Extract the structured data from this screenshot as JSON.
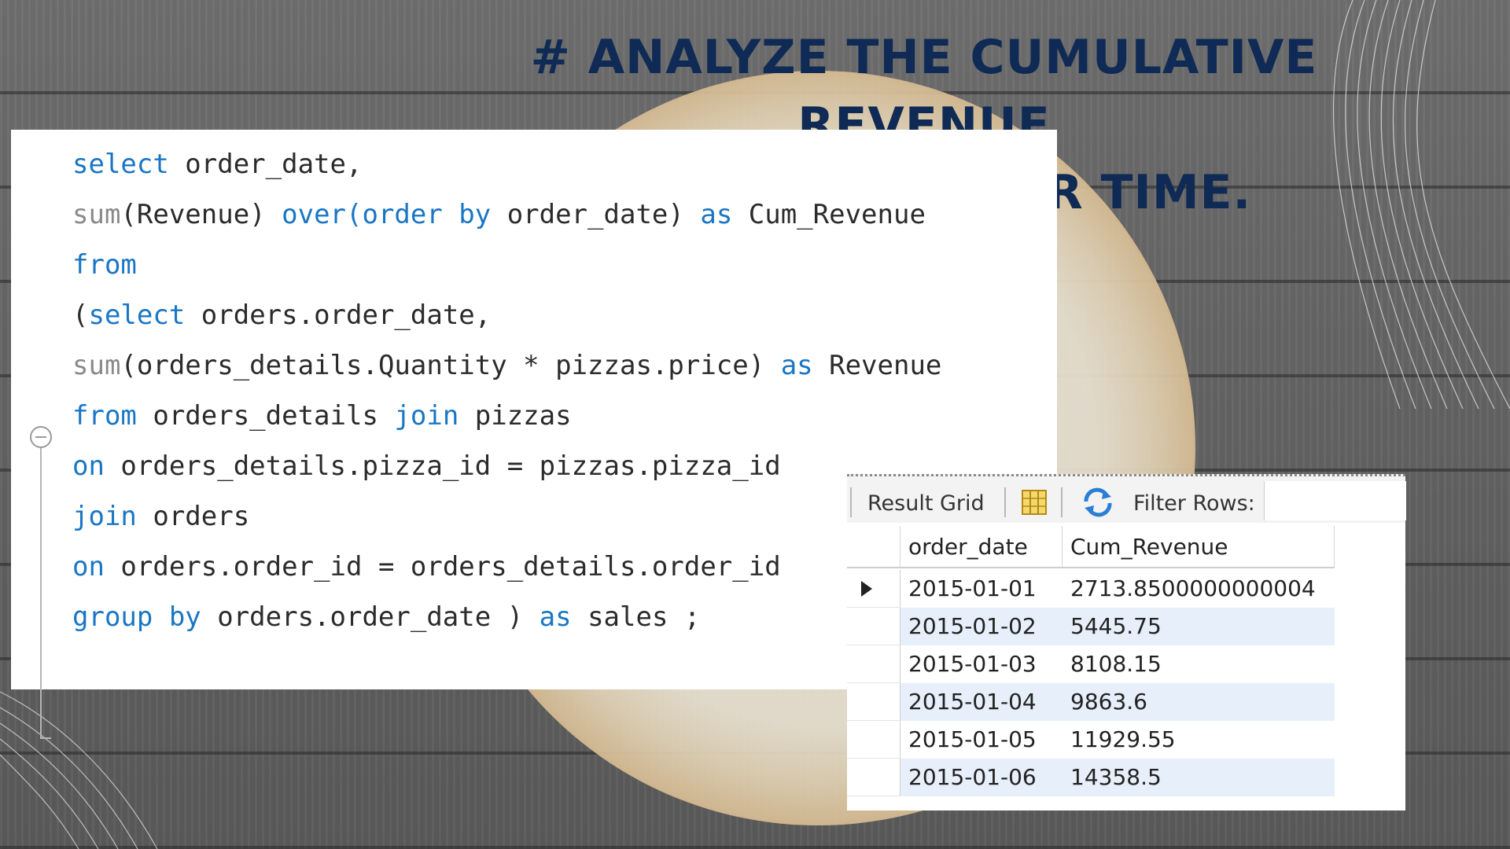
{
  "title": {
    "line1": "#  ANALYZE THE CUMULATIVE REVENUE",
    "line2": "GENERATED OVER TIME."
  },
  "code": {
    "l1_kw": "select",
    "l1_rest": " order_date,",
    "l2_fn": "sum",
    "l2_a": "(Revenue) ",
    "l2_kw1": "over(order by",
    "l2_b": " order_date) ",
    "l2_kw2": "as",
    "l2_c": " Cum_Revenue",
    "l3_kw": "from",
    "l4_a": "(",
    "l4_kw": "select",
    "l4_b": " orders.order_date,",
    "l5_fn": "sum",
    "l5_a": "(orders_details.Quantity * pizzas.price) ",
    "l5_kw": "as",
    "l5_b": " Revenue",
    "l6_kw1": "from",
    "l6_a": " orders_details ",
    "l6_kw2": "join",
    "l6_b": " pizzas",
    "l7_kw": "on",
    "l7_a": " orders_details.pizza_id = pizzas.pizza_id",
    "l8_kw": "join",
    "l8_a": " orders",
    "l9_kw": "on",
    "l9_a": " orders.order_id = orders_details.order_id",
    "l10_kw1": "group by",
    "l10_a": " orders.order_date ) ",
    "l10_kw2": "as",
    "l10_b": " sales ;"
  },
  "result_grid": {
    "toolbar": {
      "result_grid_label": "Result Grid",
      "grid_icon": "grid-view-icon",
      "refresh_icon": "refresh-icon",
      "filter_label": "Filter Rows:"
    },
    "columns": [
      "order_date",
      "Cum_Revenue"
    ],
    "rows": [
      [
        "2015-01-01",
        "2713.8500000000004"
      ],
      [
        "2015-01-02",
        "5445.75"
      ],
      [
        "2015-01-03",
        "8108.15"
      ],
      [
        "2015-01-04",
        "9863.6"
      ],
      [
        "2015-01-05",
        "11929.55"
      ],
      [
        "2015-01-06",
        "14358.5"
      ]
    ]
  },
  "colors": {
    "title": "#0e2a55",
    "keyword": "#1a76c4",
    "function": "#8a8a8a",
    "row_highlight": "#e7effb"
  }
}
